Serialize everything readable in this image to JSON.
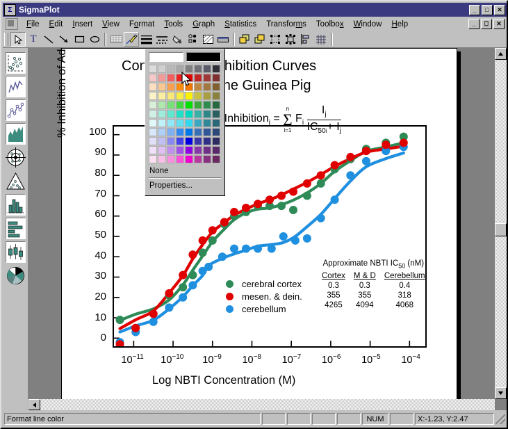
{
  "window": {
    "title": "SigmaPlot",
    "app_icon": "sigmaplot-icon",
    "minimize": "_",
    "maximize": "□",
    "close": "✕",
    "child_minimize": "_",
    "child_restore": "❐",
    "child_close": "✕"
  },
  "menu": {
    "items": [
      {
        "label": "File",
        "accel": "F"
      },
      {
        "label": "Edit",
        "accel": "E"
      },
      {
        "label": "Insert",
        "accel": "I"
      },
      {
        "label": "View",
        "accel": "V"
      },
      {
        "label": "Format",
        "accel": "o"
      },
      {
        "label": "Tools",
        "accel": "T"
      },
      {
        "label": "Graph",
        "accel": "G"
      },
      {
        "label": "Statistics",
        "accel": "S"
      },
      {
        "label": "Transforms",
        "accel": "m"
      },
      {
        "label": "Toolbox",
        "accel": "x"
      },
      {
        "label": "Window",
        "accel": "W"
      },
      {
        "label": "Help",
        "accel": "H"
      }
    ]
  },
  "toolbar": {
    "buttons": [
      {
        "name": "pointer-tool",
        "glyph": "pointer",
        "state": "selected"
      },
      {
        "name": "text-tool",
        "glyph": "T",
        "state": "normal"
      },
      {
        "name": "line-tool",
        "glyph": "line",
        "state": "normal"
      },
      {
        "name": "arrow-tool",
        "glyph": "arrow",
        "state": "normal"
      },
      {
        "name": "rectangle-tool",
        "glyph": "rect",
        "state": "normal"
      },
      {
        "name": "ellipse-tool",
        "glyph": "ellipse",
        "state": "normal"
      },
      {
        "name": "grid-tool",
        "glyph": "grid",
        "state": "normal"
      },
      {
        "name": "line-color-tool",
        "glyph": "pen",
        "state": "active"
      },
      {
        "name": "line-thickness-tool",
        "glyph": "weight",
        "state": "normal"
      },
      {
        "name": "line-style-tool",
        "glyph": "linestyle",
        "state": "normal"
      },
      {
        "name": "fill-color-tool",
        "glyph": "bucket",
        "state": "normal"
      },
      {
        "name": "symbol-tool",
        "glyph": "symbols",
        "state": "normal"
      },
      {
        "name": "fill-pattern-tool",
        "glyph": "hatch",
        "state": "normal"
      },
      {
        "name": "shade-tool",
        "glyph": "shade",
        "state": "normal"
      },
      {
        "name": "bring-to-front",
        "glyph": "front",
        "state": "normal"
      },
      {
        "name": "send-to-back",
        "glyph": "back",
        "state": "normal"
      },
      {
        "name": "group-objects",
        "glyph": "group",
        "state": "normal"
      },
      {
        "name": "ungroup-objects",
        "glyph": "ungroup",
        "state": "normal"
      },
      {
        "name": "align-objects",
        "glyph": "align",
        "state": "normal"
      },
      {
        "name": "snap-to-grid",
        "glyph": "snapgrid",
        "state": "normal"
      }
    ]
  },
  "left_palette": {
    "buttons": [
      {
        "name": "scatter-plot-icon",
        "label": "Scatter Plot"
      },
      {
        "name": "line-plot-icon",
        "label": "Line Plot"
      },
      {
        "name": "line-and-scatter-plot-icon",
        "label": "Line and Scatter Plot"
      },
      {
        "name": "area-plot-icon",
        "label": "Area Plot"
      },
      {
        "name": "polar-plot-icon",
        "label": "Polar Plot"
      },
      {
        "name": "ternary-plot-icon",
        "label": "Ternary Plot"
      },
      {
        "name": "vertical-bar-chart-icon",
        "label": "Vertical Bar Chart"
      },
      {
        "name": "horizontal-bar-chart-icon",
        "label": "Horizontal Bar Chart"
      },
      {
        "name": "box-plot-icon",
        "label": "Box Plot"
      },
      {
        "name": "pie-chart-icon",
        "label": "Pie Chart"
      }
    ]
  },
  "color_picker": {
    "none_label": "None",
    "properties_label": "Properties...",
    "white_swatch": "#ffffff",
    "black_swatch": "#000000",
    "selected_index": 20,
    "rows": [
      [
        "#dcdcdc",
        "#d0d0d0",
        "#b8b8b8",
        "#a8a8a8",
        "#808080",
        "#707078",
        "#5a5a68",
        "#303038"
      ],
      [
        "#f4c8c8",
        "#f29a9a",
        "#f06060",
        "#ee2020",
        "#e00000",
        "#c02828",
        "#a03838",
        "#803030"
      ],
      [
        "#fae0c0",
        "#f8c890",
        "#f8a050",
        "#fa8c10",
        "#f07800",
        "#c08840",
        "#a07840",
        "#806030"
      ],
      [
        "#fcf4c8",
        "#faeea0",
        "#f8e878",
        "#f8ee40",
        "#fbf200",
        "#c8c040",
        "#a8a040",
        "#88823c"
      ],
      [
        "#d8f0d8",
        "#aee8ae",
        "#78e078",
        "#40d840",
        "#00e000",
        "#3ca83c",
        "#2e8c4e",
        "#286840"
      ],
      [
        "#d0f0e8",
        "#a0ecdc",
        "#60e8d0",
        "#20e0c8",
        "#00d8c0",
        "#38b0a8",
        "#2e8888",
        "#2a6060"
      ],
      [
        "#e0f8f8",
        "#c0f0f8",
        "#90e8f8",
        "#60e0f0",
        "#30d8f0",
        "#3aa8c0",
        "#2e8898",
        "#2a6878"
      ],
      [
        "#d8e8fa",
        "#b0d0f8",
        "#80b0f4",
        "#3088f0",
        "#0078e8",
        "#3870b8",
        "#305898",
        "#2c4878"
      ],
      [
        "#e0e0f8",
        "#c0c0f4",
        "#8888f0",
        "#4040e8",
        "#0000e0",
        "#3838a8",
        "#303088",
        "#2c2c60"
      ],
      [
        "#f0e0f8",
        "#e0c0f4",
        "#c090ee",
        "#a050e8",
        "#9000e0",
        "#8838a8",
        "#703088",
        "#582a68"
      ],
      [
        "#fae0f0",
        "#f8c0e8",
        "#f890e0",
        "#f850d8",
        "#f000d0",
        "#b838a0",
        "#883080",
        "#6a2a60"
      ]
    ]
  },
  "document": {
    "title_line1": "Concentration-Inhibition Curves",
    "title_line2": "for NBTI in the Guinea Pig"
  },
  "status_bar": {
    "message": "Format line color",
    "num_indicator": "NUM",
    "coordinates": "X:-1.23, Y:2.47"
  },
  "chart_data": {
    "type": "scatter",
    "title": "Concentration-Inhibition Curves for NBTI in the Guinea Pig",
    "xlabel": "Log NBTI Concentration (M)",
    "ylabel": "% Inhibition of Adenosine Uptake",
    "xlim": [
      -11.5,
      -3.6
    ],
    "ylim": [
      -4,
      104
    ],
    "x_tick_labels": [
      "10-11",
      "10-10",
      "10-9",
      "10-8",
      "10-7",
      "10-6",
      "10-5",
      "10-4"
    ],
    "x_tick_values": [
      -11,
      -10,
      -9,
      -8,
      -7,
      -6,
      -5,
      -4
    ],
    "y_tick_labels": [
      "0",
      "10",
      "20",
      "30",
      "40",
      "50",
      "60",
      "70",
      "80",
      "90",
      "100"
    ],
    "y_tick_values": [
      0,
      10,
      20,
      30,
      40,
      50,
      60,
      70,
      80,
      90,
      100
    ],
    "grid": false,
    "legend_position": "inside-lower-center",
    "equation": "% Inhibition_j = sum(i=1..n) F_i * I_j / (IC_50i + I_j)",
    "equation_parts": {
      "lhs": "% Inhibition",
      "lhs_sub": "j",
      "equals": "=",
      "sum_upper": "n",
      "sum_lower": "i=1",
      "factor": "F",
      "factor_sub": "i",
      "num": "I",
      "num_sub": "j",
      "den1": "IC",
      "den1_sub": "50",
      "den1_sub2": "i",
      "den_plus": "+ I",
      "den_sub": "j"
    },
    "series": [
      {
        "name": "cerebral cortex",
        "color": "#2e8b57",
        "points": [
          [
            -11.35,
            9
          ],
          [
            -10.95,
            5
          ],
          [
            -10.5,
            12
          ],
          [
            -10.1,
            21
          ],
          [
            -9.75,
            25
          ],
          [
            -9.5,
            31
          ],
          [
            -9.25,
            42
          ],
          [
            -9.0,
            48
          ],
          [
            -8.7,
            56
          ],
          [
            -8.45,
            60
          ],
          [
            -8.15,
            62
          ],
          [
            -7.85,
            65
          ],
          [
            -7.55,
            65
          ],
          [
            -7.25,
            65
          ],
          [
            -6.95,
            63
          ],
          [
            -6.6,
            70
          ],
          [
            -6.25,
            76
          ],
          [
            -5.9,
            83
          ],
          [
            -5.5,
            88
          ],
          [
            -5.1,
            93
          ],
          [
            -4.6,
            96
          ],
          [
            -4.15,
            99
          ]
        ]
      },
      {
        "name": "mesen. & dein.",
        "color": "#e00000",
        "points": [
          [
            -11.35,
            -3
          ],
          [
            -10.95,
            5
          ],
          [
            -10.5,
            12
          ],
          [
            -10.1,
            22
          ],
          [
            -9.75,
            31
          ],
          [
            -9.5,
            41
          ],
          [
            -9.25,
            48
          ],
          [
            -9.0,
            53
          ],
          [
            -8.7,
            57
          ],
          [
            -8.45,
            62
          ],
          [
            -8.15,
            64
          ],
          [
            -7.85,
            66
          ],
          [
            -7.55,
            68
          ],
          [
            -7.25,
            70
          ],
          [
            -6.95,
            72
          ],
          [
            -6.6,
            76
          ],
          [
            -6.25,
            80
          ],
          [
            -5.9,
            85
          ],
          [
            -5.5,
            89
          ],
          [
            -5.1,
            92
          ],
          [
            -4.6,
            95
          ],
          [
            -4.15,
            96
          ]
        ]
      },
      {
        "name": "cerebellum",
        "color": "#1f8fe0",
        "points": [
          [
            -11.35,
            -2
          ],
          [
            -10.95,
            3
          ],
          [
            -10.5,
            8
          ],
          [
            -10.1,
            15
          ],
          [
            -9.75,
            20
          ],
          [
            -9.5,
            26
          ],
          [
            -9.25,
            33
          ],
          [
            -9.1,
            35
          ],
          [
            -8.75,
            40
          ],
          [
            -8.45,
            44
          ],
          [
            -8.15,
            44
          ],
          [
            -7.85,
            44
          ],
          [
            -7.5,
            44
          ],
          [
            -7.2,
            50
          ],
          [
            -6.9,
            48
          ],
          [
            -6.6,
            49
          ],
          [
            -6.25,
            59
          ],
          [
            -5.9,
            68
          ],
          [
            -5.5,
            80
          ],
          [
            -5.1,
            87
          ],
          [
            -4.6,
            92
          ],
          [
            -4.15,
            94
          ]
        ]
      }
    ],
    "legend": [
      {
        "label": "cerebral cortex",
        "color": "#2e8b57"
      },
      {
        "label": "mesen. & dein.",
        "color": "#e00000"
      },
      {
        "label": "cerebellum",
        "color": "#1f8fe0"
      }
    ],
    "annotation_table": {
      "title": "Approximate  NBTI IC50 (nM)",
      "title_main": "Approximate  NBTI IC",
      "title_sub": "50",
      "title_unit": " (nM)",
      "columns": [
        "Cortex",
        "M & D",
        "Cerebellum"
      ],
      "rows": [
        [
          "0.3",
          "0.3",
          "0.4"
        ],
        [
          "355",
          "355",
          "318"
        ],
        [
          "4265",
          "4094",
          "4068"
        ]
      ]
    }
  }
}
